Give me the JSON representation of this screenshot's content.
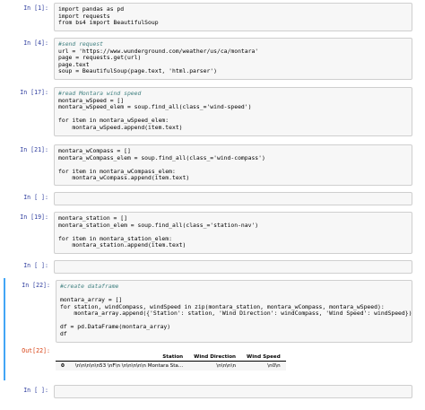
{
  "cells": [
    {
      "prompt": "In [1]:",
      "lines": [
        "import pandas as pd",
        "import requests",
        "from bs4 import BeautifulSoup"
      ]
    },
    {
      "prompt": "In [4]:",
      "lines": [
        "#send request",
        "url = 'https://www.wunderground.com/weather/us/ca/montara'",
        "page = requests.get(url)",
        "page.text",
        "soup = BeautifulSoup(page.text, 'html.parser')"
      ]
    },
    {
      "prompt": "In [17]:",
      "lines": [
        "#read Montara wind speed",
        "montara_wSpeed = []",
        "montara_wSpeed_elem = soup.find_all(class_='wind-speed')",
        "",
        "for item in montara_wSpeed_elem:",
        "    montara_wSpeed.append(item.text)"
      ]
    },
    {
      "prompt": "In [21]:",
      "lines": [
        "montara_wCompass = []",
        "montara_wCompass_elem = soup.find_all(class_='wind-compass')",
        "",
        "for item in montara_wCompass_elem:",
        "    montara_wCompass.append(item.text)"
      ]
    },
    {
      "prompt": "In [ ]:",
      "lines": [
        ""
      ]
    },
    {
      "prompt": "In [19]:",
      "lines": [
        "montara_station = []",
        "montara_station_elem = soup.find_all(class_='station-nav')",
        "",
        "for item in montara_station_elem:",
        "    montara_station.append(item.text)"
      ]
    },
    {
      "prompt": "In [ ]:",
      "lines": [
        ""
      ]
    },
    {
      "prompt": "In [22]:",
      "lines": [
        "#create dataframe",
        "",
        "montara_array = []",
        "for station, windCompass, windSpeed in zip(montara_station, montara_wCompass, montara_wSpeed):",
        "    montara_array.append({'Station': station, 'Wind Direction': windCompass, 'Wind Speed': windSpeed})",
        "",
        "df = pd.DataFrame(montara_array)",
        "df"
      ]
    },
    {
      "prompt": "In [ ]:",
      "lines": [
        ""
      ]
    }
  ],
  "output": {
    "prompt": "Out[22]:",
    "columns": [
      "",
      "Station",
      "Wind Direction",
      "Wind Speed"
    ],
    "rows": [
      [
        "0",
        "\\n\\n\\n\\n\\n53 \\nF\\n \\n\\n\\n\\n\\n Montara Sta...",
        "\\n\\n\\n\\n",
        "\\n0\\n"
      ]
    ]
  },
  "colors": {
    "prompt_in": "#303f9f",
    "prompt_out": "#d84315",
    "selected_border": "#42a5f5",
    "code_bg": "#f7f7f7"
  }
}
